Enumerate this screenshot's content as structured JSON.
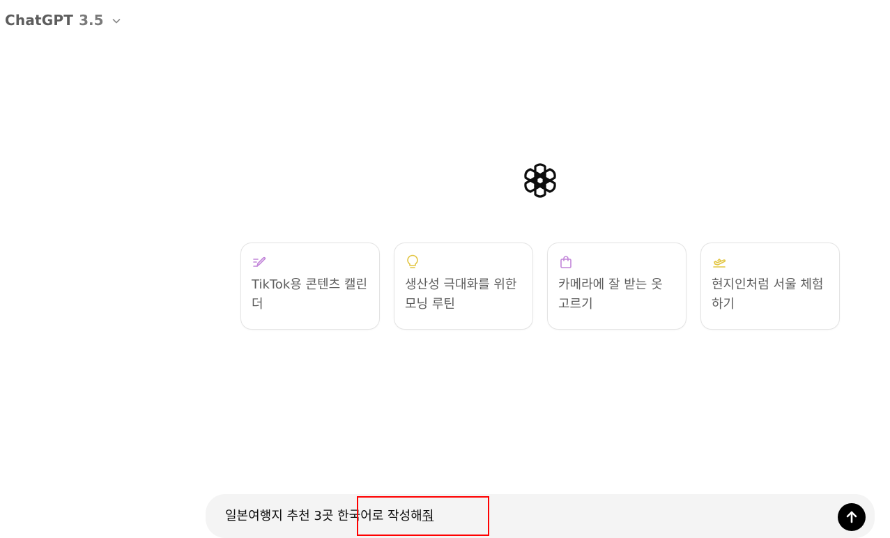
{
  "header": {
    "model_name": "ChatGPT",
    "model_version": "3.5"
  },
  "icons": {
    "logo": "openai-logo-icon",
    "model_dropdown": "chevron-down-icon",
    "send": "arrow-up-icon"
  },
  "suggestions": [
    {
      "icon": "pen-icon",
      "icon_color": "#c285d9",
      "text": "TikTok용 콘텐츠 캘린더"
    },
    {
      "icon": "lightbulb-icon",
      "icon_color": "#e2c541",
      "text": "생산성 극대화를 위한 모닝 루틴"
    },
    {
      "icon": "shopping-bag-icon",
      "icon_color": "#c285d9",
      "text": "카메라에 잘 받는 옷 고르기"
    },
    {
      "icon": "airplane-icon",
      "icon_color": "#e2c541",
      "text": "현지인처럼 서울 체험하기"
    }
  ],
  "composer": {
    "input_text": "일본여행지 추천 3곳 한국어로 작성해",
    "composing_char": "줘",
    "send_label": "Send"
  },
  "colors": {
    "highlight": "#ff0000",
    "send_button": "#000000",
    "composer_bg": "#f4f4f4"
  }
}
